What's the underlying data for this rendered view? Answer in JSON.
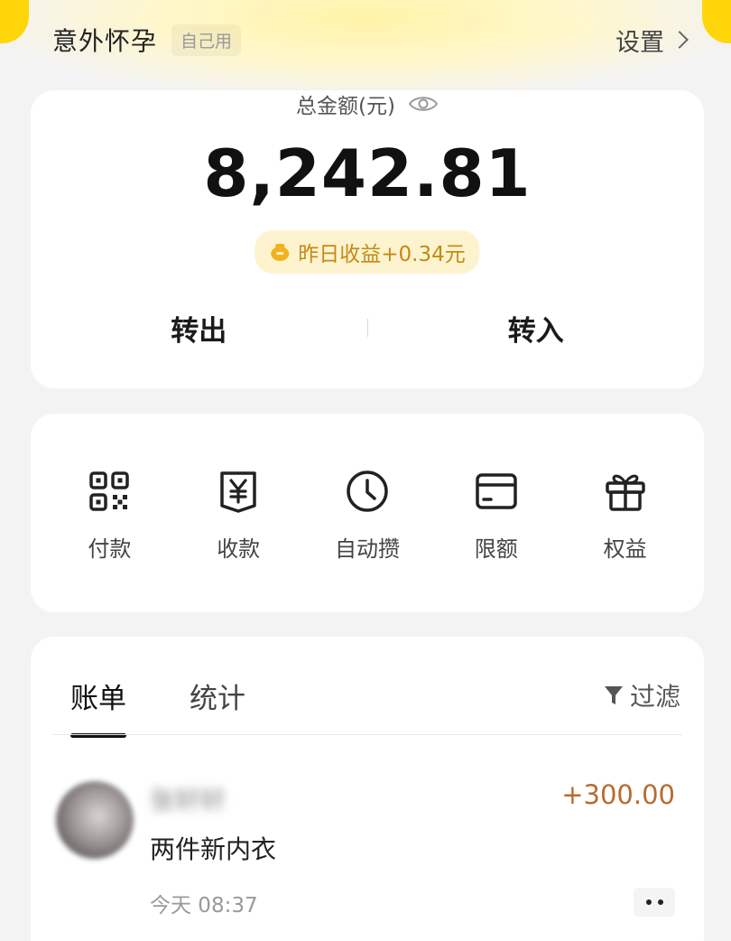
{
  "header": {
    "title": "意外怀孕",
    "badge": "自己用",
    "settings_label": "设置"
  },
  "balance": {
    "label": "总金额(元)",
    "amount": "8,242.81",
    "yield_text": "昨日收益+0.34元",
    "transfer_out": "转出",
    "transfer_in": "转入"
  },
  "tools": [
    {
      "label": "付款",
      "icon": "qr-code-icon"
    },
    {
      "label": "收款",
      "icon": "yen-receipt-icon"
    },
    {
      "label": "自动攒",
      "icon": "clock-icon"
    },
    {
      "label": "限额",
      "icon": "card-icon"
    },
    {
      "label": "权益",
      "icon": "gift-icon"
    }
  ],
  "bills": {
    "tabs": [
      "账单",
      "统计"
    ],
    "active_tab": "账单",
    "filter_label": "过滤",
    "items": [
      {
        "name": "张轩轩",
        "description": "两件新内衣",
        "time": "今天 08:37",
        "amount": "+300.00"
      }
    ]
  },
  "colors": {
    "accent": "#ffd60a",
    "income": "#b76c2e",
    "yield_text": "#c58a12"
  }
}
